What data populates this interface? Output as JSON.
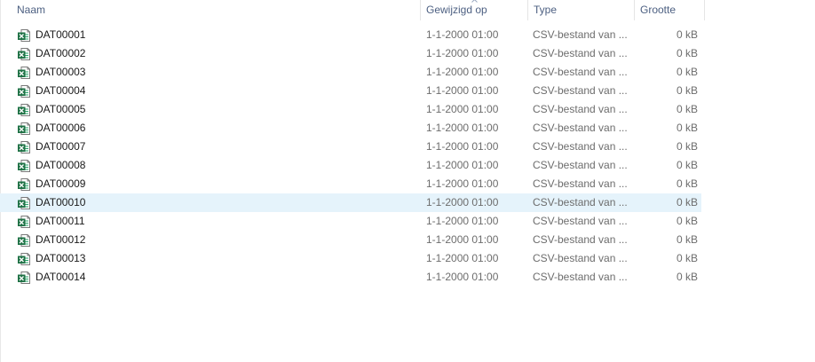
{
  "header": {
    "name": "Naam",
    "date": "Gewijzigd op",
    "type": "Type",
    "size": "Grootte"
  },
  "selected_index": 9,
  "icon": "excel-csv-file-icon",
  "colors": {
    "selected_row": "#e5f3fb",
    "header_text": "#4d6082",
    "excel_green": "#1e7145"
  },
  "files": [
    {
      "name": "DAT00001",
      "date": "1-1-2000 01:00",
      "type": "CSV-bestand van ...",
      "size": "0 kB"
    },
    {
      "name": "DAT00002",
      "date": "1-1-2000 01:00",
      "type": "CSV-bestand van ...",
      "size": "0 kB"
    },
    {
      "name": "DAT00003",
      "date": "1-1-2000 01:00",
      "type": "CSV-bestand van ...",
      "size": "0 kB"
    },
    {
      "name": "DAT00004",
      "date": "1-1-2000 01:00",
      "type": "CSV-bestand van ...",
      "size": "0 kB"
    },
    {
      "name": "DAT00005",
      "date": "1-1-2000 01:00",
      "type": "CSV-bestand van ...",
      "size": "0 kB"
    },
    {
      "name": "DAT00006",
      "date": "1-1-2000 01:00",
      "type": "CSV-bestand van ...",
      "size": "0 kB"
    },
    {
      "name": "DAT00007",
      "date": "1-1-2000 01:00",
      "type": "CSV-bestand van ...",
      "size": "0 kB"
    },
    {
      "name": "DAT00008",
      "date": "1-1-2000 01:00",
      "type": "CSV-bestand van ...",
      "size": "0 kB"
    },
    {
      "name": "DAT00009",
      "date": "1-1-2000 01:00",
      "type": "CSV-bestand van ...",
      "size": "0 kB"
    },
    {
      "name": "DAT00010",
      "date": "1-1-2000 01:00",
      "type": "CSV-bestand van ...",
      "size": "0 kB"
    },
    {
      "name": "DAT00011",
      "date": "1-1-2000 01:00",
      "type": "CSV-bestand van ...",
      "size": "0 kB"
    },
    {
      "name": "DAT00012",
      "date": "1-1-2000 01:00",
      "type": "CSV-bestand van ...",
      "size": "0 kB"
    },
    {
      "name": "DAT00013",
      "date": "1-1-2000 01:00",
      "type": "CSV-bestand van ...",
      "size": "0 kB"
    },
    {
      "name": "DAT00014",
      "date": "1-1-2000 01:00",
      "type": "CSV-bestand van ...",
      "size": "0 kB"
    }
  ]
}
